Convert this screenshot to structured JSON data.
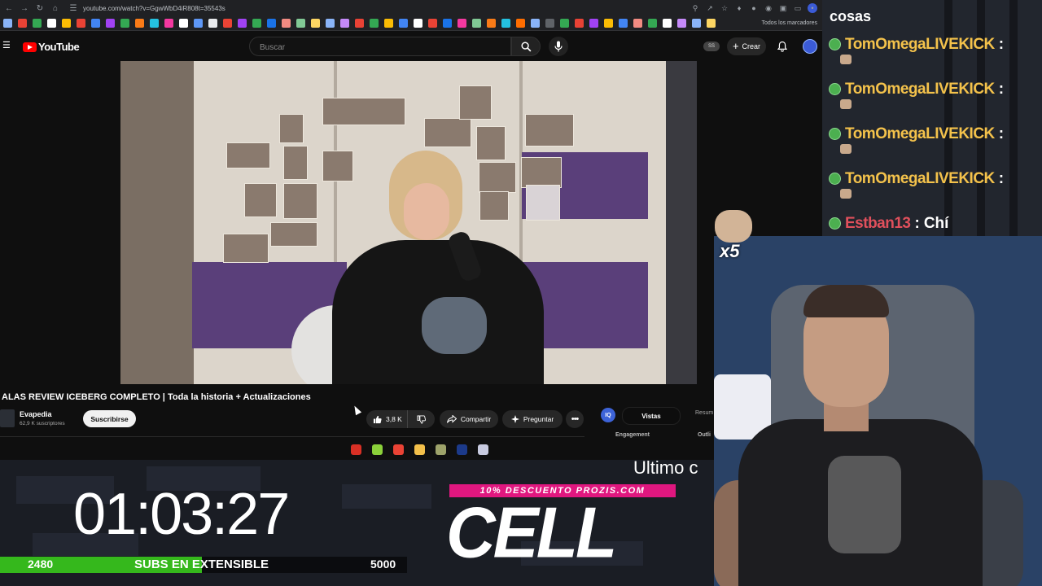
{
  "browser": {
    "url": "youtube.com/watch?v=GgwWbD4iR808t=35543s",
    "bookmarks_all_label": "Todos los marcadores",
    "bookmark_colors": [
      "#8ab4f8",
      "#e94235",
      "#34a853",
      "#ffffff",
      "#fbbc04",
      "#ea4335",
      "#4285f4",
      "#a142f4",
      "#34a853",
      "#fa7b17",
      "#24c1e0",
      "#f538a0",
      "#ffffff",
      "#5e97f6",
      "#e8eaed",
      "#ea4335",
      "#a142f4",
      "#34a853",
      "#1a73e8",
      "#f28b82",
      "#81c995",
      "#fdd663",
      "#8ab4f8",
      "#c58af9",
      "#e94235",
      "#34a853",
      "#fbbc04",
      "#4285f4",
      "#ffffff",
      "#ea4335",
      "#1a73e8",
      "#f538a0",
      "#81c995",
      "#fa7b17",
      "#24c1e0",
      "#ff6d00",
      "#8ab4f8",
      "#5f6368",
      "#34a853",
      "#e94235",
      "#a142f4",
      "#fbbc04",
      "#4285f4",
      "#f28b82",
      "#34a853",
      "#ffffff",
      "#c58af9",
      "#8ab4f8",
      "#fdd663"
    ]
  },
  "youtube": {
    "logo_text": "YouTube",
    "search_placeholder": "Buscar",
    "ss_badge": "SS",
    "create_label": "Crear",
    "video_title": "ALAS REVIEW ICEBERG COMPLETO | Toda la historia + Actualizaciones",
    "channel_name": "Evapedia",
    "channel_subs": "62,9 K suscriptores",
    "subscribe_label": "Suscribirse",
    "like_count": "3,8 K",
    "share_label": "Compartir",
    "ask_label": "Preguntar",
    "stats_icon_text": "IQ",
    "stats_tab_active": "Vistas",
    "stats_tab_other": "Resum",
    "stats_label_engagement": "Engagement",
    "stats_label_outliers": "Outli"
  },
  "taskbar": {
    "icons": [
      {
        "name": "obs-icon",
        "color": "#d93025"
      },
      {
        "name": "spotify-icon",
        "color": "#8bd13a"
      },
      {
        "name": "chrome-icon",
        "color": "#ea4335"
      },
      {
        "name": "folder-icon",
        "color": "#f3c04a"
      },
      {
        "name": "app-icon",
        "color": "#9ea36a"
      },
      {
        "name": "photoshop-icon",
        "color": "#1c3a8a"
      },
      {
        "name": "discord-icon",
        "color": "#c8cbe0"
      }
    ]
  },
  "overlay": {
    "timer": "01:03:27",
    "subs_current": "2480",
    "subs_goal": "5000",
    "subs_progress": 0.496,
    "subs_label": "SUBS EN EXTENSIBLE",
    "ticker_text": "Ultimo c",
    "promo_tag": "10% DESCUENTO PROZIS.COM",
    "promo_brand": "CELL"
  },
  "chat": {
    "heading": "cosas",
    "messages": [
      {
        "user": "TomOmegaLIVEKICK",
        "color": "#f4c24b",
        "sep": ":",
        "text": ""
      },
      {
        "user": "TomOmegaLIVEKICK",
        "color": "#f4c24b",
        "sep": ":",
        "text": ""
      },
      {
        "user": "TomOmegaLIVEKICK",
        "color": "#f4c24b",
        "sep": ":",
        "text": ""
      },
      {
        "user": "TomOmegaLIVEKICK",
        "color": "#f4c24b",
        "sep": ":",
        "text": ""
      },
      {
        "user": "Estban13",
        "color": "#e0505c",
        "sep": ":",
        "text": "Chí"
      }
    ],
    "combo_multiplier": "x5"
  }
}
